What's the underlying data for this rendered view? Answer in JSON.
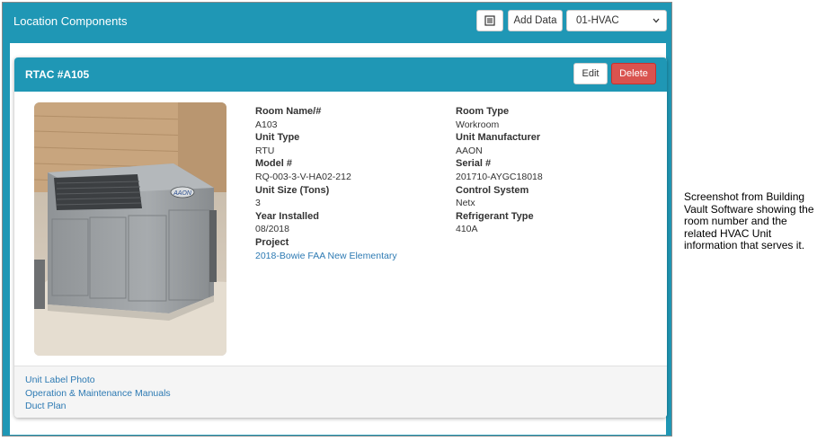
{
  "panel": {
    "title": "Location Components",
    "add_data_label": "Add Data",
    "system_select": {
      "selected": "01-HVAC"
    }
  },
  "unit": {
    "title": "RTAC #A105",
    "edit_label": "Edit",
    "delete_label": "Delete",
    "fields_left": [
      {
        "label": "Room Name/#",
        "value": "A103"
      },
      {
        "label": "Unit Type",
        "value": "RTU"
      },
      {
        "label": "Model #",
        "value": "RQ-003-3-V-HA02-212"
      },
      {
        "label": "Unit Size (Tons)",
        "value": "3"
      },
      {
        "label": "Year Installed",
        "value": "08/2018"
      },
      {
        "label": "Project",
        "value": "2018-Bowie FAA New Elementary"
      }
    ],
    "fields_right": [
      {
        "label": "Room Type",
        "value": "Workroom"
      },
      {
        "label": "Unit Manufacturer",
        "value": "AAON"
      },
      {
        "label": "Serial #",
        "value": "201710-AYGC18018"
      },
      {
        "label": "Control System",
        "value": "Netx"
      },
      {
        "label": "Refrigerant Type",
        "value": "410A"
      }
    ],
    "photo_logo": "AAON",
    "links": [
      "Unit Label Photo",
      "Operation & Maintenance Manuals",
      "Duct Plan"
    ]
  },
  "caption": "Screenshot from Building Vault Software showing the room number and the related HVAC Unit information that serves it.",
  "colors": {
    "header_teal": "#1f97b5",
    "delete_red": "#d9534f",
    "link_blue": "#2d7ab3"
  },
  "icons": {
    "list": "list-icon",
    "chevron": "chevron-down-icon"
  }
}
